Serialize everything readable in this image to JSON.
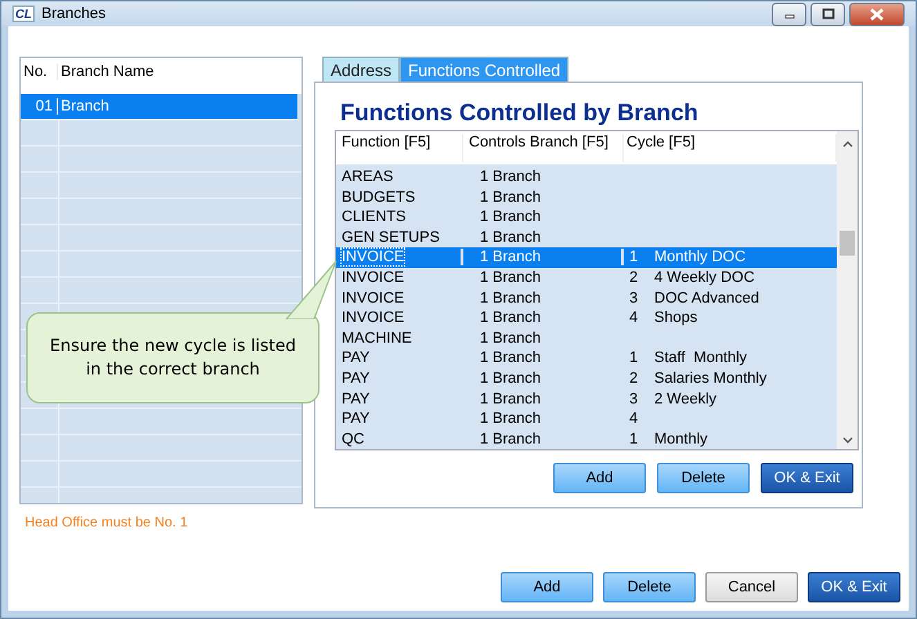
{
  "window": {
    "logo": "CL",
    "title": "Branches"
  },
  "branch_list": {
    "columns": [
      "No.",
      "Branch Name"
    ],
    "rows": [
      {
        "number": "01",
        "name": "Branch",
        "selected": true
      }
    ]
  },
  "note": "Head Office must be No. 1",
  "tabs": [
    {
      "label": "Address",
      "selected": false
    },
    {
      "label": "Functions Controlled",
      "selected": true
    }
  ],
  "panel": {
    "heading": "Functions Controlled by Branch",
    "table": {
      "columns": [
        "Function [F5]",
        "Controls Branch [F5]",
        "Cycle [F5]"
      ],
      "rows": [
        {
          "function": "AREAS",
          "branch": "1 Branch",
          "selected": false
        },
        {
          "function": "BUDGETS",
          "branch": "1 Branch",
          "selected": false
        },
        {
          "function": "CLIENTS",
          "branch": "1 Branch",
          "selected": false
        },
        {
          "function": "GEN SETUPS",
          "branch": "1 Branch",
          "selected": false
        },
        {
          "function": "INVOICE",
          "branch": "1 Branch",
          "cycle_no": "1",
          "cycle": "Monthly DOC",
          "selected": true
        },
        {
          "function": "INVOICE",
          "branch": "1 Branch",
          "cycle_no": "2",
          "cycle": "4 Weekly DOC",
          "selected": false
        },
        {
          "function": "INVOICE",
          "branch": "1 Branch",
          "cycle_no": "3",
          "cycle": "DOC Advanced",
          "selected": false
        },
        {
          "function": "INVOICE",
          "branch": "1 Branch",
          "cycle_no": "4",
          "cycle": "Shops",
          "selected": false
        },
        {
          "function": "MACHINE",
          "branch": "1 Branch",
          "selected": false
        },
        {
          "function": "PAY",
          "branch": "1 Branch",
          "cycle_no": "1",
          "cycle": "Staff  Monthly",
          "selected": false
        },
        {
          "function": "PAY",
          "branch": "1 Branch",
          "cycle_no": "2",
          "cycle": "Salaries Monthly",
          "selected": false
        },
        {
          "function": "PAY",
          "branch": "1 Branch",
          "cycle_no": "3",
          "cycle": "2 Weekly",
          "selected": false
        },
        {
          "function": "PAY",
          "branch": "1 Branch",
          "cycle_no": "4",
          "selected": false
        },
        {
          "function": "QC",
          "branch": "1 Branch",
          "cycle_no": "1",
          "cycle": "Monthly",
          "selected": false
        }
      ]
    },
    "buttons": [
      {
        "label": "Add",
        "kind": "normal"
      },
      {
        "label": "Delete",
        "kind": "normal"
      },
      {
        "label": "OK & Exit",
        "kind": "primary"
      }
    ]
  },
  "callout": "Ensure the new cycle is listed in the correct branch",
  "buttons": [
    {
      "label": "Add",
      "kind": "normal"
    },
    {
      "label": "Delete",
      "kind": "normal"
    },
    {
      "label": "Cancel",
      "kind": "neutral"
    },
    {
      "label": "OK & Exit",
      "kind": "primary"
    }
  ]
}
